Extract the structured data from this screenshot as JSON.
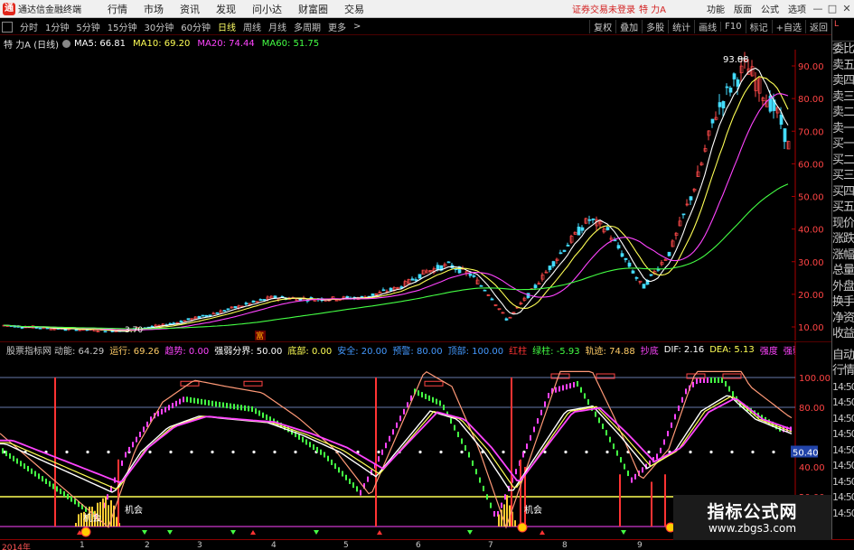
{
  "topbar": {
    "app_title": "通达信金融终端",
    "menus": [
      "行情",
      "市场",
      "资讯",
      "发现",
      "问小达",
      "财富圈",
      "交易"
    ],
    "warning": "证券交易未登录",
    "stock": "特 力A",
    "right_menus": [
      "功能",
      "版面",
      "公式",
      "选项"
    ],
    "window_buttons": [
      "—",
      "□",
      "✕"
    ]
  },
  "period_bar": {
    "tabs": [
      "分时",
      "1分钟",
      "5分钟",
      "15分钟",
      "30分钟",
      "60分钟",
      "日线",
      "周线",
      "月线",
      "多周期",
      "更多"
    ],
    "active_tab": "日线",
    "right_buttons": [
      "复权",
      "叠加",
      "多股",
      "统计",
      "画线",
      "F10",
      "标记",
      "+自选",
      "返回"
    ]
  },
  "ma_bar": {
    "stock_label": "特 力A (日线)",
    "items": [
      {
        "label": "MA5: 66.81",
        "color": "#ffffff"
      },
      {
        "label": "MA10: 69.20",
        "color": "#ffff55"
      },
      {
        "label": "MA20: 74.44",
        "color": "#ff44ff"
      },
      {
        "label": "MA60: 51.75",
        "color": "#44ff44"
      }
    ]
  },
  "side_panel": {
    "corner": "L",
    "items": [
      "委比",
      "卖五",
      "卖四",
      "卖三",
      "卖二",
      "卖一",
      "买一",
      "买二",
      "买三",
      "买四",
      "买五",
      "现价",
      "涨跌",
      "涨幅",
      "总量",
      "外盘",
      "换手",
      "净资",
      "收益"
    ],
    "lower_items": [
      "自动",
      "行情"
    ],
    "time_items": [
      "14:50",
      "14:50",
      "14:50",
      "14:50",
      "14:50",
      "14:50",
      "14:50",
      "14:50",
      "14:50"
    ]
  },
  "kline": {
    "y_axis": [
      "90.00",
      "80.00",
      "70.00",
      "60.00",
      "50.00",
      "40.00",
      "30.00",
      "20.00",
      "10.00"
    ],
    "high_label": "93.88",
    "low_label": "3.70",
    "marker_label": "富"
  },
  "ind_bar": {
    "name": "股票指标网",
    "items": [
      {
        "label": "动能: 64.29",
        "color": "#c8c8c8"
      },
      {
        "label": "运行: 69.26",
        "color": "#ffcc66"
      },
      {
        "label": "趋势: 0.00",
        "color": "#ff44ff"
      },
      {
        "label": "强弱分界: 50.00",
        "color": "#ffffff"
      },
      {
        "label": "底部: 0.00",
        "color": "#ffff55"
      },
      {
        "label": "安全: 20.00",
        "color": "#4499ff"
      },
      {
        "label": "预警: 80.00",
        "color": "#4499ff"
      },
      {
        "label": "顶部: 100.00",
        "color": "#4499ff"
      },
      {
        "label": "红柱",
        "color": "#ff3333"
      },
      {
        "label": "绿柱: -5.93",
        "color": "#44ff44"
      },
      {
        "label": "轨迹: 74.88",
        "color": "#ffcc66"
      },
      {
        "label": "抄底",
        "color": "#ff44ff"
      },
      {
        "label": "DIF: 2.16",
        "color": "#ffffff"
      },
      {
        "label": "DEA: 5.13",
        "color": "#ffff55"
      },
      {
        "label": "强度",
        "color": "#ff44ff"
      },
      {
        "label": "强弱",
        "color": "#ff44ff"
      }
    ]
  },
  "ind_chart": {
    "y_axis": [
      "100.00",
      "80.00",
      "40.00",
      "20.00"
    ],
    "value_box": "50.40",
    "chance_labels": [
      "机会",
      "机会",
      "机会"
    ]
  },
  "date_bar": {
    "labels": [
      "2014年",
      "1",
      "2",
      "3",
      "4",
      "5",
      "6",
      "7",
      "8",
      "9"
    ]
  },
  "watermark": {
    "title": "指标公式网",
    "url": "www.zbgs3.com"
  },
  "colors": {
    "up": "#ff4a4a",
    "down": "#44ddff",
    "ma5": "#ffffff",
    "ma10": "#ffff55",
    "ma20": "#ff44ff",
    "ma60": "#44ff44",
    "axis_red": "#aa0000"
  }
}
